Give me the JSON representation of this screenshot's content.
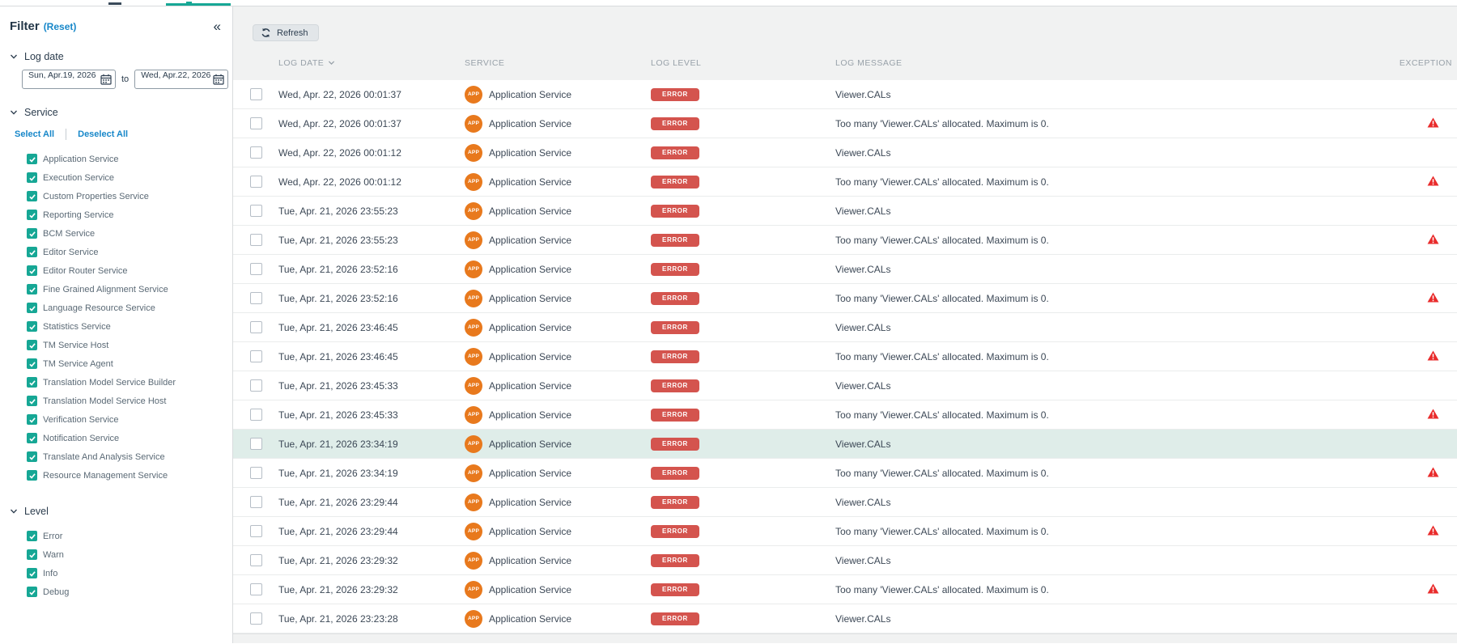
{
  "colors": {
    "accent": "#16a795",
    "link_blue": "#1787c9",
    "error_badge": "#d4544e",
    "app_badge_orange": "#e8791d",
    "warning_red": "#e92b2b",
    "highlight_row": "#dfede9",
    "navy_text": "#233748"
  },
  "sidebar": {
    "title": "Filter",
    "reset_label": "(Reset)",
    "collapse_glyph": "«",
    "log_date": {
      "label": "Log date",
      "from_value": "Sun, Apr.19, 2026",
      "to_label": "to",
      "to_value": "Wed, Apr.22, 2026"
    },
    "service": {
      "label": "Service",
      "select_all": "Select All",
      "deselect_all": "Deselect All",
      "items": [
        {
          "label": "Application Service",
          "checked": true
        },
        {
          "label": "Execution Service",
          "checked": true
        },
        {
          "label": "Custom Properties Service",
          "checked": true
        },
        {
          "label": "Reporting Service",
          "checked": true
        },
        {
          "label": "BCM Service",
          "checked": true
        },
        {
          "label": "Editor Service",
          "checked": true
        },
        {
          "label": "Editor Router Service",
          "checked": true
        },
        {
          "label": "Fine Grained Alignment Service",
          "checked": true
        },
        {
          "label": "Language Resource Service",
          "checked": true
        },
        {
          "label": "Statistics Service",
          "checked": true
        },
        {
          "label": "TM Service Host",
          "checked": true
        },
        {
          "label": "TM Service Agent",
          "checked": true
        },
        {
          "label": "Translation Model Service Builder",
          "checked": true
        },
        {
          "label": "Translation Model Service Host",
          "checked": true
        },
        {
          "label": "Verification Service",
          "checked": true
        },
        {
          "label": "Notification Service",
          "checked": true
        },
        {
          "label": "Translate And Analysis Service",
          "checked": true
        },
        {
          "label": "Resource Management Service",
          "checked": true
        }
      ]
    },
    "level": {
      "label": "Level",
      "items": [
        {
          "label": "Error",
          "checked": true
        },
        {
          "label": "Warn",
          "checked": true
        },
        {
          "label": "Info",
          "checked": true
        },
        {
          "label": "Debug",
          "checked": true
        }
      ]
    }
  },
  "toolbar": {
    "refresh_label": "Refresh"
  },
  "table": {
    "columns": [
      "LOG DATE",
      "SERVICE",
      "LOG LEVEL",
      "LOG MESSAGE",
      "EXCEPTION"
    ],
    "rows": [
      {
        "date": "Wed, Apr. 22, 2026 00:01:37",
        "service": "Application Service",
        "service_badge": "APP",
        "level": "ERROR",
        "message": "Viewer.CALs",
        "exception": false,
        "highlighted": false
      },
      {
        "date": "Wed, Apr. 22, 2026 00:01:37",
        "service": "Application Service",
        "service_badge": "APP",
        "level": "ERROR",
        "message": "Too many 'Viewer.CALs' allocated. Maximum is 0.",
        "exception": true,
        "highlighted": false
      },
      {
        "date": "Wed, Apr. 22, 2026 00:01:12",
        "service": "Application Service",
        "service_badge": "APP",
        "level": "ERROR",
        "message": "Viewer.CALs",
        "exception": false,
        "highlighted": false
      },
      {
        "date": "Wed, Apr. 22, 2026 00:01:12",
        "service": "Application Service",
        "service_badge": "APP",
        "level": "ERROR",
        "message": "Too many 'Viewer.CALs' allocated. Maximum is 0.",
        "exception": true,
        "highlighted": false
      },
      {
        "date": "Tue, Apr. 21, 2026 23:55:23",
        "service": "Application Service",
        "service_badge": "APP",
        "level": "ERROR",
        "message": "Viewer.CALs",
        "exception": false,
        "highlighted": false
      },
      {
        "date": "Tue, Apr. 21, 2026 23:55:23",
        "service": "Application Service",
        "service_badge": "APP",
        "level": "ERROR",
        "message": "Too many 'Viewer.CALs' allocated. Maximum is 0.",
        "exception": true,
        "highlighted": false
      },
      {
        "date": "Tue, Apr. 21, 2026 23:52:16",
        "service": "Application Service",
        "service_badge": "APP",
        "level": "ERROR",
        "message": "Viewer.CALs",
        "exception": false,
        "highlighted": false
      },
      {
        "date": "Tue, Apr. 21, 2026 23:52:16",
        "service": "Application Service",
        "service_badge": "APP",
        "level": "ERROR",
        "message": "Too many 'Viewer.CALs' allocated. Maximum is 0.",
        "exception": true,
        "highlighted": false
      },
      {
        "date": "Tue, Apr. 21, 2026 23:46:45",
        "service": "Application Service",
        "service_badge": "APP",
        "level": "ERROR",
        "message": "Viewer.CALs",
        "exception": false,
        "highlighted": false
      },
      {
        "date": "Tue, Apr. 21, 2026 23:46:45",
        "service": "Application Service",
        "service_badge": "APP",
        "level": "ERROR",
        "message": "Too many 'Viewer.CALs' allocated. Maximum is 0.",
        "exception": true,
        "highlighted": false
      },
      {
        "date": "Tue, Apr. 21, 2026 23:45:33",
        "service": "Application Service",
        "service_badge": "APP",
        "level": "ERROR",
        "message": "Viewer.CALs",
        "exception": false,
        "highlighted": false
      },
      {
        "date": "Tue, Apr. 21, 2026 23:45:33",
        "service": "Application Service",
        "service_badge": "APP",
        "level": "ERROR",
        "message": "Too many 'Viewer.CALs' allocated. Maximum is 0.",
        "exception": true,
        "highlighted": false
      },
      {
        "date": "Tue, Apr. 21, 2026 23:34:19",
        "service": "Application Service",
        "service_badge": "APP",
        "level": "ERROR",
        "message": "Viewer.CALs",
        "exception": false,
        "highlighted": true
      },
      {
        "date": "Tue, Apr. 21, 2026 23:34:19",
        "service": "Application Service",
        "service_badge": "APP",
        "level": "ERROR",
        "message": "Too many 'Viewer.CALs' allocated. Maximum is 0.",
        "exception": true,
        "highlighted": false
      },
      {
        "date": "Tue, Apr. 21, 2026 23:29:44",
        "service": "Application Service",
        "service_badge": "APP",
        "level": "ERROR",
        "message": "Viewer.CALs",
        "exception": false,
        "highlighted": false
      },
      {
        "date": "Tue, Apr. 21, 2026 23:29:44",
        "service": "Application Service",
        "service_badge": "APP",
        "level": "ERROR",
        "message": "Too many 'Viewer.CALs' allocated. Maximum is 0.",
        "exception": true,
        "highlighted": false
      },
      {
        "date": "Tue, Apr. 21, 2026 23:29:32",
        "service": "Application Service",
        "service_badge": "APP",
        "level": "ERROR",
        "message": "Viewer.CALs",
        "exception": false,
        "highlighted": false
      },
      {
        "date": "Tue, Apr. 21, 2026 23:29:32",
        "service": "Application Service",
        "service_badge": "APP",
        "level": "ERROR",
        "message": "Too many 'Viewer.CALs' allocated. Maximum is 0.",
        "exception": true,
        "highlighted": false
      },
      {
        "date": "Tue, Apr. 21, 2026 23:23:28",
        "service": "Application Service",
        "service_badge": "APP",
        "level": "ERROR",
        "message": "Viewer.CALs",
        "exception": false,
        "highlighted": false
      }
    ]
  }
}
